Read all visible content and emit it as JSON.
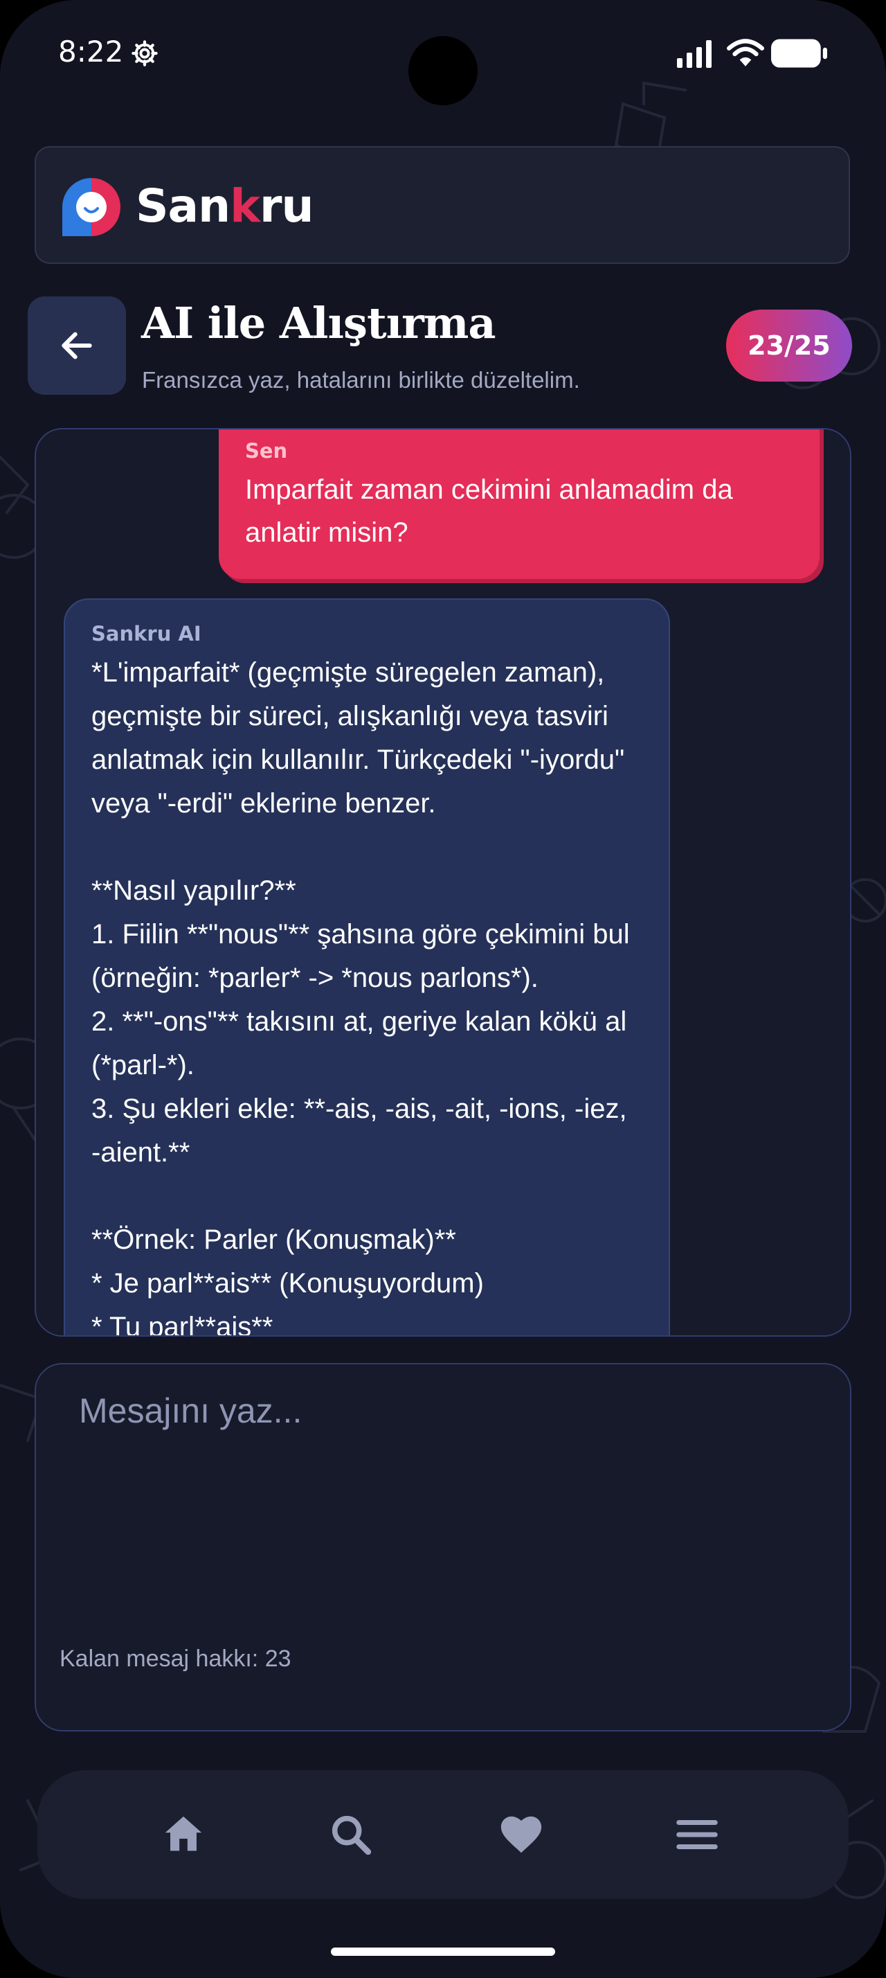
{
  "status_bar": {
    "time": "8:22"
  },
  "brand": {
    "name_part1": "San",
    "name_part2": "k",
    "name_part3": "ru"
  },
  "header": {
    "title": "AI ile Alıştırma",
    "subtitle": "Fransızca yaz, hatalarını birlikte düzeltelim.",
    "counter": "23/25"
  },
  "messages": [
    {
      "sender": "Sen",
      "text": "Imparfait zaman cekimini anlamadim da anlatir misin?"
    },
    {
      "sender": "Sankru AI",
      "text": "*L'imparfait* (geçmişte süregelen zaman), geçmişte bir süreci, alışkanlığı veya tasviri anlatmak için kullanılır. Türkçedeki \"-iyordu\" veya \"-erdi\" eklerine benzer.\n\n**Nasıl yapılır?**\n1. Fiilin **\"nous\"** şahsına göre çekimini bul (örneğin: *parler* -> *nous parlons*).\n2. **\"-ons\"** takısını at, geriye kalan kökü al (*parl-*).\n3. Şu ekleri ekle: **-ais, -ais, -ait, -ions, -iez, -aient.**\n\n**Örnek: Parler (Konuşmak)**\n* Je parl**ais** (Konuşuyordum)\n* Tu parl**ais**"
    }
  ],
  "composer": {
    "placeholder": "Mesajını yaz...",
    "remaining": "Kalan mesaj hakkı: 23"
  },
  "nav": {
    "items": [
      "home-icon",
      "search-icon",
      "heart-icon",
      "menu-icon"
    ]
  },
  "colors": {
    "accent": "#e42d58",
    "bubble_ai": "#253158",
    "background": "#121421"
  }
}
